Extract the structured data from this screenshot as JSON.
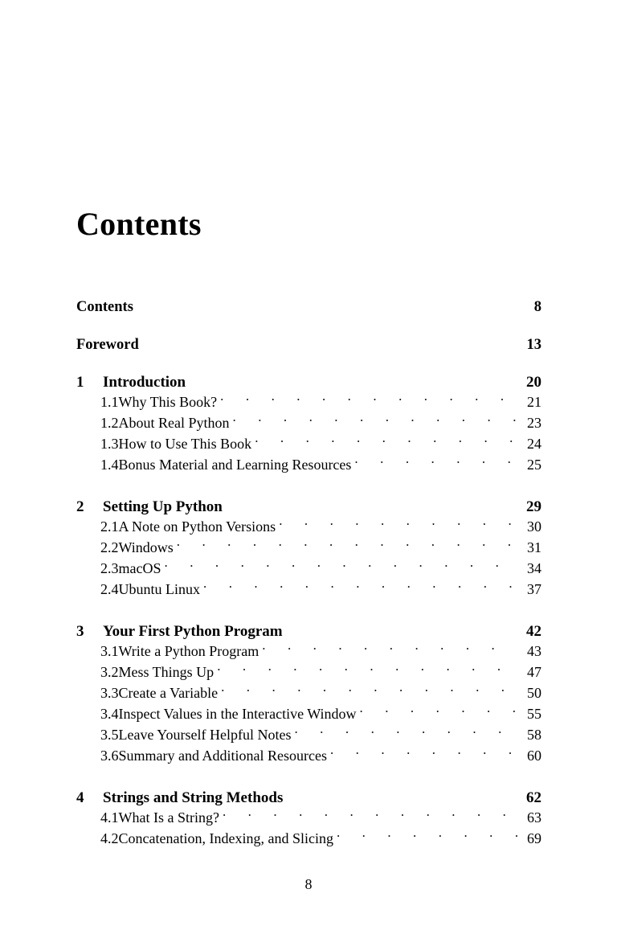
{
  "page": {
    "title": "Contents",
    "folio": "8"
  },
  "front_matter": [
    {
      "label": "Contents",
      "page": "8"
    },
    {
      "label": "Foreword",
      "page": "13"
    }
  ],
  "chapters": [
    {
      "num": "1",
      "title": "Introduction",
      "page": "20",
      "sections": [
        {
          "num": "1.1",
          "title": "Why This Book?",
          "page": "21"
        },
        {
          "num": "1.2",
          "title": "About Real Python",
          "page": "23"
        },
        {
          "num": "1.3",
          "title": "How to Use This Book",
          "page": "24"
        },
        {
          "num": "1.4",
          "title": "Bonus Material and Learning Resources",
          "page": "25"
        }
      ]
    },
    {
      "num": "2",
      "title": "Setting Up Python",
      "page": "29",
      "sections": [
        {
          "num": "2.1",
          "title": "A Note on Python Versions",
          "page": "30"
        },
        {
          "num": "2.2",
          "title": "Windows",
          "page": "31"
        },
        {
          "num": "2.3",
          "title": "macOS",
          "page": "34"
        },
        {
          "num": "2.4",
          "title": "Ubuntu Linux",
          "page": "37"
        }
      ]
    },
    {
      "num": "3",
      "title": "Your First Python Program",
      "page": "42",
      "sections": [
        {
          "num": "3.1",
          "title": "Write a Python Program",
          "page": "43"
        },
        {
          "num": "3.2",
          "title": "Mess Things Up",
          "page": "47"
        },
        {
          "num": "3.3",
          "title": "Create a Variable",
          "page": "50"
        },
        {
          "num": "3.4",
          "title": "Inspect Values in the Interactive Window",
          "page": "55"
        },
        {
          "num": "3.5",
          "title": "Leave Yourself Helpful Notes",
          "page": "58"
        },
        {
          "num": "3.6",
          "title": "Summary and Additional Resources",
          "page": "60"
        }
      ]
    },
    {
      "num": "4",
      "title": "Strings and String Methods",
      "page": "62",
      "sections": [
        {
          "num": "4.1",
          "title": "What Is a String?",
          "page": "63"
        },
        {
          "num": "4.2",
          "title": "Concatenation, Indexing, and Slicing",
          "page": "69"
        }
      ]
    }
  ]
}
